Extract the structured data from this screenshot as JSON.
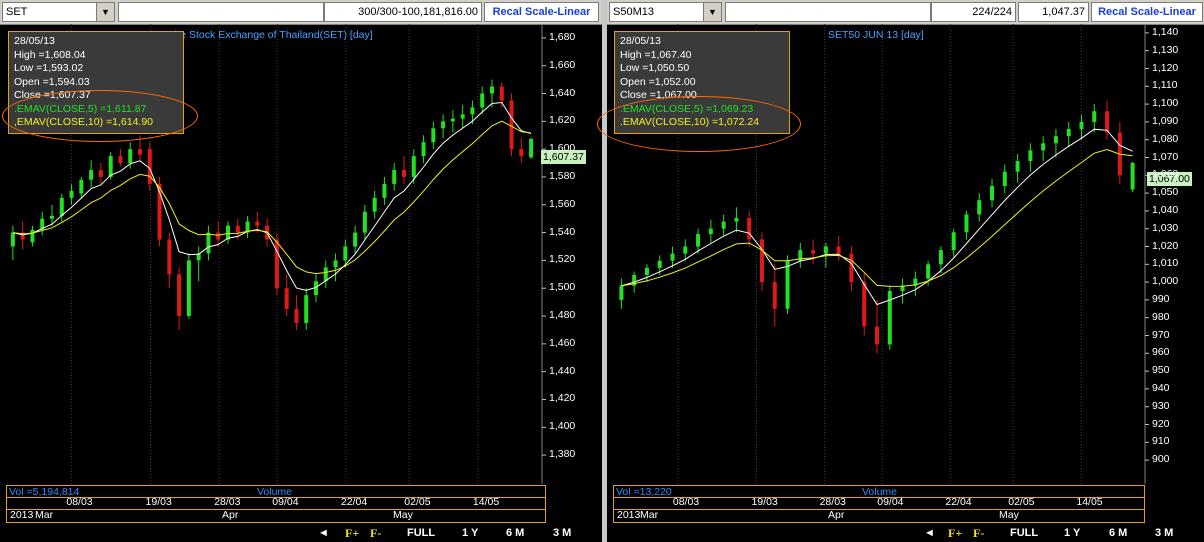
{
  "left": {
    "symbol": "SET",
    "count_field": "300/300",
    "value_field": "-100,181,816.00",
    "recal_label": "Recal Scale-Linear",
    "chart_title": "The Stock Exchange of Thailand(SET) [day]",
    "info": {
      "date": "28/05/13",
      "high": "High  =1,608.04",
      "low": "Low  =1,593.02",
      "open": "Open  =1,594.03",
      "close": "Close  =1,607.37",
      "ema5": ".EMAV(CLOSE,5)   =1,611.87",
      "ema10": ",EMAV(CLOSE,10)   =1,614.90"
    },
    "last_price": "1,607.37",
    "y_ticks": [
      "1,680",
      "1,660",
      "1,640",
      "1,620",
      "1,600",
      "1,580",
      "1,560",
      "1,540",
      "1,520",
      "1,500",
      "1,480",
      "1,460",
      "1,440",
      "1,420",
      "1,400",
      "1,380"
    ],
    "volume_label": "Vol  =5,194,814",
    "volume_word": "Volume",
    "date_ticks": [
      "08/03",
      "19/03",
      "28/03",
      "09/04",
      "22/04",
      "02/05",
      "14/05"
    ],
    "months": [
      "2013",
      "Mar",
      "Apr",
      "May"
    ]
  },
  "right": {
    "symbol": "S50M13",
    "count_field": "224/224",
    "value_field": "1,047.37",
    "recal_label": "Recal Scale-Linear",
    "chart_title": "SET50 JUN 13  [day]",
    "info": {
      "date": "28/05/13",
      "high": "High  =1,067.40",
      "low": "Low  =1,050.50",
      "open": "Open  =1,052.00",
      "close": "Close  =1,067.00",
      "ema5": ".EMAV(CLOSE,5)   =1,069.23",
      "ema10": ".EMAV(CLOSE,10)   =1,072.24"
    },
    "last_price": "1,067.00",
    "y_ticks": [
      "1,140",
      "1,130",
      "1,120",
      "1,110",
      "1,100",
      "1,090",
      "1,080",
      "1,070",
      "1,060",
      "1,050",
      "1,040",
      "1,030",
      "1,020",
      "1,010",
      "1,000",
      "990",
      "980",
      "970",
      "960",
      "950",
      "940",
      "930",
      "920",
      "910",
      "900"
    ],
    "volume_label": "Vol  =13,220",
    "volume_word": "Volume",
    "date_ticks": [
      "08/03",
      "19/03",
      "28/03",
      "09/04",
      "22/04",
      "02/05",
      "14/05"
    ],
    "months": [
      "2013",
      "Mar",
      "Apr",
      "May"
    ]
  },
  "nav": {
    "f_plus": "F+",
    "f_minus": "F-",
    "full": "FULL",
    "y1": "1 Y",
    "m6": "6 M",
    "m3": "3 M"
  },
  "colors": {
    "up": "#22e022",
    "down": "#e01818",
    "ema5": "#ffffff",
    "ema10": "#f0f020",
    "accent_border": "#e0a020",
    "title_blue": "#4aa0ff"
  },
  "chart_data": [
    {
      "type": "candlestick",
      "title": "The Stock Exchange of Thailand(SET) [day]",
      "ylim": [
        1370,
        1690
      ],
      "series": [
        {
          "name": "SET",
          "ohlc": [
            [
              1530,
              1545,
              1520,
              1540
            ],
            [
              1540,
              1548,
              1528,
              1535
            ],
            [
              1533,
              1545,
              1530,
              1542
            ],
            [
              1542,
              1555,
              1538,
              1550
            ],
            [
              1550,
              1560,
              1545,
              1552
            ],
            [
              1552,
              1568,
              1548,
              1565
            ],
            [
              1565,
              1575,
              1560,
              1570
            ],
            [
              1568,
              1580,
              1565,
              1578
            ],
            [
              1578,
              1592,
              1572,
              1585
            ],
            [
              1585,
              1590,
              1575,
              1580
            ],
            [
              1580,
              1598,
              1578,
              1595
            ],
            [
              1595,
              1600,
              1588,
              1590
            ],
            [
              1590,
              1605,
              1586,
              1600
            ],
            [
              1600,
              1610,
              1592,
              1596
            ],
            [
              1600,
              1605,
              1570,
              1575
            ],
            [
              1575,
              1580,
              1530,
              1535
            ],
            [
              1535,
              1540,
              1500,
              1510
            ],
            [
              1510,
              1515,
              1470,
              1480
            ],
            [
              1480,
              1525,
              1478,
              1520
            ],
            [
              1520,
              1530,
              1505,
              1525
            ],
            [
              1525,
              1545,
              1520,
              1540
            ],
            [
              1540,
              1548,
              1530,
              1535
            ],
            [
              1535,
              1548,
              1532,
              1545
            ],
            [
              1545,
              1550,
              1535,
              1540
            ],
            [
              1540,
              1552,
              1536,
              1548
            ],
            [
              1548,
              1555,
              1540,
              1545
            ],
            [
              1545,
              1550,
              1530,
              1535
            ],
            [
              1535,
              1540,
              1495,
              1500
            ],
            [
              1500,
              1510,
              1480,
              1485
            ],
            [
              1485,
              1495,
              1470,
              1475
            ],
            [
              1475,
              1500,
              1470,
              1495
            ],
            [
              1495,
              1510,
              1490,
              1505
            ],
            [
              1505,
              1520,
              1500,
              1515
            ],
            [
              1515,
              1525,
              1505,
              1520
            ],
            [
              1520,
              1535,
              1515,
              1530
            ],
            [
              1530,
              1545,
              1525,
              1540
            ],
            [
              1540,
              1560,
              1535,
              1555
            ],
            [
              1555,
              1570,
              1550,
              1565
            ],
            [
              1565,
              1580,
              1560,
              1575
            ],
            [
              1575,
              1590,
              1570,
              1585
            ],
            [
              1585,
              1595,
              1575,
              1580
            ],
            [
              1580,
              1600,
              1575,
              1595
            ],
            [
              1595,
              1610,
              1590,
              1605
            ],
            [
              1605,
              1620,
              1600,
              1615
            ],
            [
              1615,
              1625,
              1608,
              1620
            ],
            [
              1620,
              1628,
              1612,
              1622
            ],
            [
              1622,
              1632,
              1615,
              1625
            ],
            [
              1625,
              1635,
              1618,
              1630
            ],
            [
              1630,
              1645,
              1625,
              1640
            ],
            [
              1640,
              1650,
              1630,
              1645
            ],
            [
              1645,
              1648,
              1630,
              1635
            ],
            [
              1635,
              1640,
              1595,
              1600
            ],
            [
              1600,
              1608,
              1590,
              1595
            ],
            [
              1594.03,
              1608.04,
              1593.02,
              1607.37
            ]
          ]
        },
        {
          "name": ".EMAV(CLOSE,5)",
          "last": 1611.87
        },
        {
          "name": ",EMAV(CLOSE,10)",
          "last": 1614.9
        }
      ]
    },
    {
      "type": "candlestick",
      "title": "SET50 JUN 13  [day]",
      "ylim": [
        895,
        1145
      ],
      "series": [
        {
          "name": "S50M13",
          "ohlc": [
            [
              990,
              1002,
              985,
              998
            ],
            [
              998,
              1006,
              994,
              1004
            ],
            [
              1004,
              1010,
              1000,
              1008
            ],
            [
              1008,
              1015,
              1004,
              1012
            ],
            [
              1012,
              1020,
              1008,
              1016
            ],
            [
              1016,
              1024,
              1012,
              1020
            ],
            [
              1020,
              1030,
              1016,
              1027
            ],
            [
              1027,
              1035,
              1022,
              1030
            ],
            [
              1030,
              1038,
              1026,
              1034
            ],
            [
              1034,
              1042,
              1028,
              1036
            ],
            [
              1036,
              1040,
              1020,
              1024
            ],
            [
              1024,
              1028,
              995,
              1000
            ],
            [
              1000,
              1010,
              975,
              985
            ],
            [
              985,
              1015,
              982,
              1012
            ],
            [
              1012,
              1022,
              1008,
              1018
            ],
            [
              1018,
              1024,
              1010,
              1016
            ],
            [
              1016,
              1022,
              1008,
              1020
            ],
            [
              1020,
              1026,
              1012,
              1016
            ],
            [
              1016,
              1020,
              995,
              1000
            ],
            [
              1000,
              1005,
              970,
              975
            ],
            [
              975,
              990,
              960,
              965
            ],
            [
              965,
              998,
              962,
              995
            ],
            [
              995,
              1002,
              988,
              998
            ],
            [
              998,
              1006,
              992,
              1002
            ],
            [
              1002,
              1012,
              998,
              1010
            ],
            [
              1010,
              1020,
              1005,
              1018
            ],
            [
              1018,
              1030,
              1014,
              1028
            ],
            [
              1028,
              1040,
              1024,
              1038
            ],
            [
              1038,
              1050,
              1034,
              1046
            ],
            [
              1046,
              1058,
              1042,
              1054
            ],
            [
              1054,
              1066,
              1050,
              1062
            ],
            [
              1062,
              1072,
              1056,
              1068
            ],
            [
              1068,
              1078,
              1062,
              1074
            ],
            [
              1074,
              1082,
              1068,
              1078
            ],
            [
              1078,
              1086,
              1070,
              1082
            ],
            [
              1082,
              1090,
              1076,
              1086
            ],
            [
              1086,
              1094,
              1080,
              1090
            ],
            [
              1090,
              1100,
              1084,
              1096
            ],
            [
              1096,
              1102,
              1080,
              1084
            ],
            [
              1084,
              1090,
              1055,
              1060
            ],
            [
              1052,
              1067.4,
              1050.5,
              1067
            ]
          ]
        },
        {
          "name": ".EMAV(CLOSE,5)",
          "last": 1069.23
        },
        {
          "name": ".EMAV(CLOSE,10)",
          "last": 1072.24
        }
      ]
    }
  ]
}
